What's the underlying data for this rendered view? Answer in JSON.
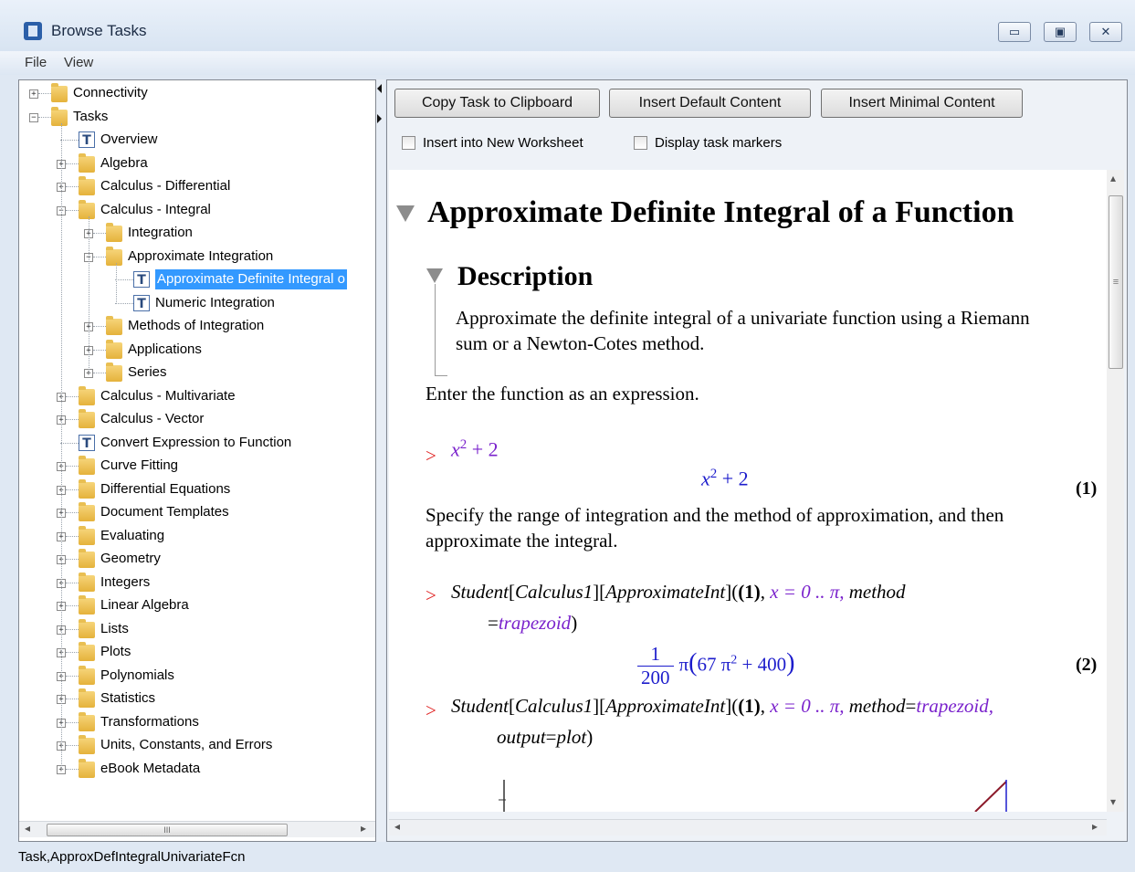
{
  "window": {
    "title": "Browse Tasks",
    "controls": {
      "minimize": "▭",
      "maximize": "▣",
      "close": "✕"
    }
  },
  "menu": {
    "file": "File",
    "view": "View"
  },
  "tree": [
    {
      "label": "Connectivity",
      "type": "folder",
      "level": 0,
      "state": "collapsed"
    },
    {
      "label": "Tasks",
      "type": "folder",
      "level": 0,
      "state": "expanded"
    },
    {
      "label": "Overview",
      "type": "task",
      "level": 1
    },
    {
      "label": "Algebra",
      "type": "folder",
      "level": 1,
      "state": "collapsed"
    },
    {
      "label": "Calculus - Differential",
      "type": "folder",
      "level": 1,
      "state": "collapsed"
    },
    {
      "label": "Calculus - Integral",
      "type": "folder",
      "level": 1,
      "state": "expanded"
    },
    {
      "label": "Integration",
      "type": "folder",
      "level": 2,
      "state": "collapsed"
    },
    {
      "label": "Approximate Integration",
      "type": "folder",
      "level": 2,
      "state": "expanded"
    },
    {
      "label": "Approximate Definite Integral o",
      "type": "task",
      "level": 3,
      "selected": true
    },
    {
      "label": "Numeric Integration",
      "type": "task",
      "level": 3
    },
    {
      "label": "Methods of Integration",
      "type": "folder",
      "level": 2,
      "state": "collapsed"
    },
    {
      "label": "Applications",
      "type": "folder",
      "level": 2,
      "state": "collapsed"
    },
    {
      "label": "Series",
      "type": "folder",
      "level": 2,
      "state": "collapsed"
    },
    {
      "label": "Calculus - Multivariate",
      "type": "folder",
      "level": 1,
      "state": "collapsed"
    },
    {
      "label": "Calculus - Vector",
      "type": "folder",
      "level": 1,
      "state": "collapsed"
    },
    {
      "label": "Convert Expression to Function",
      "type": "task",
      "level": 1
    },
    {
      "label": "Curve Fitting",
      "type": "folder",
      "level": 1,
      "state": "collapsed"
    },
    {
      "label": "Differential Equations",
      "type": "folder",
      "level": 1,
      "state": "collapsed"
    },
    {
      "label": "Document Templates",
      "type": "folder",
      "level": 1,
      "state": "collapsed"
    },
    {
      "label": "Evaluating",
      "type": "folder",
      "level": 1,
      "state": "collapsed"
    },
    {
      "label": "Geometry",
      "type": "folder",
      "level": 1,
      "state": "collapsed"
    },
    {
      "label": "Integers",
      "type": "folder",
      "level": 1,
      "state": "collapsed"
    },
    {
      "label": "Linear Algebra",
      "type": "folder",
      "level": 1,
      "state": "collapsed"
    },
    {
      "label": "Lists",
      "type": "folder",
      "level": 1,
      "state": "collapsed"
    },
    {
      "label": "Plots",
      "type": "folder",
      "level": 1,
      "state": "collapsed"
    },
    {
      "label": "Polynomials",
      "type": "folder",
      "level": 1,
      "state": "collapsed"
    },
    {
      "label": "Statistics",
      "type": "folder",
      "level": 1,
      "state": "collapsed"
    },
    {
      "label": "Transformations",
      "type": "folder",
      "level": 1,
      "state": "collapsed"
    },
    {
      "label": "Units, Constants, and Errors",
      "type": "folder",
      "level": 1,
      "state": "collapsed"
    },
    {
      "label": "eBook Metadata",
      "type": "folder",
      "level": 1,
      "state": "collapsed"
    }
  ],
  "scroll": {
    "left_arrow": "◂",
    "right_arrow": "▸",
    "up_arrow": "▴",
    "down_arrow": "▾",
    "grip": "III",
    "vgrip": "≡"
  },
  "toolbar": {
    "copy_label": "Copy Task to Clipboard",
    "insert_default_label": "Insert Default Content",
    "insert_minimal_label": "Insert Minimal Content",
    "new_worksheet_label": "Insert into New Worksheet",
    "task_markers_label": "Display task markers",
    "new_worksheet_checked": false,
    "task_markers_checked": false
  },
  "document": {
    "title": "Approximate Definite Integral of a Function",
    "section_heading": "Description",
    "description": "Approximate the definite integral of a univariate function using a Riemann sum or a Newton-Cotes method.",
    "enter_text": "Enter the function as an expression.",
    "prompt": ">",
    "input1": {
      "base": "x",
      "exp": "2",
      "rest": "+ 2"
    },
    "output1": {
      "base": "x",
      "exp": "2",
      "rest": "+ 2",
      "label": "(1)"
    },
    "specify_text": "Specify the range of integration and the method of approximation, and then approximate the integral.",
    "cmd2": {
      "part1": "Student",
      "part2": "Calculus1",
      "part3": "ApproximateInt",
      "ref": "(1)",
      "range": "x = 0 .. π,",
      "method_kw": "method",
      "eq": "=",
      "method_val": "trapezoid"
    },
    "output2": {
      "num": "1",
      "den": "200",
      "pi": "π",
      "inner": "67 π",
      "exp": "2",
      "tail": "+ 400",
      "label": "(2)"
    },
    "cmd3": {
      "part1": "Student",
      "part2": "Calculus1",
      "part3": "ApproximateInt",
      "ref": "(1)",
      "range": "x = 0 .. π,",
      "method_kw": "method",
      "eq": "=",
      "method_val": "trapezoid,",
      "output_kw": "output",
      "output_val": "plot"
    }
  },
  "status": {
    "text": "Task,ApproxDefIntegralUnivariateFcn"
  }
}
